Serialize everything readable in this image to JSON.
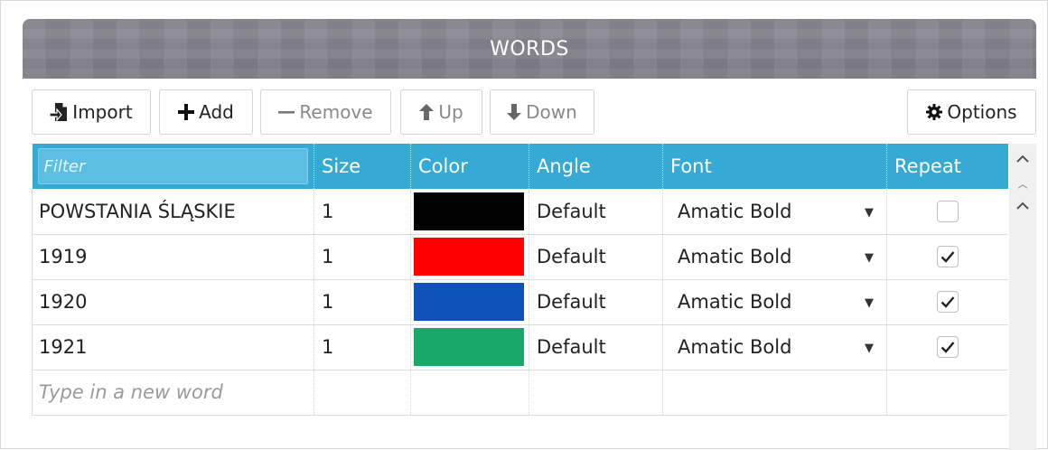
{
  "panel": {
    "title": "WORDS"
  },
  "toolbar": {
    "import_label": "Import",
    "add_label": "Add",
    "remove_label": "Remove",
    "up_label": "Up",
    "down_label": "Down",
    "options_label": "Options"
  },
  "table": {
    "filter_placeholder": "Filter",
    "columns": [
      "Size",
      "Color",
      "Angle",
      "Font",
      "Repeat"
    ],
    "rows": [
      {
        "word": "POWSTANIA ŚLĄSKIE",
        "size": "1",
        "color": "#000000",
        "angle": "Default",
        "font": "Amatic Bold",
        "repeat": false
      },
      {
        "word": "1919",
        "size": "1",
        "color": "#ff0000",
        "angle": "Default",
        "font": "Amatic Bold",
        "repeat": true
      },
      {
        "word": "1920",
        "size": "1",
        "color": "#0f52ba",
        "angle": "Default",
        "font": "Amatic Bold",
        "repeat": true
      },
      {
        "word": "1921",
        "size": "1",
        "color": "#1aa86b",
        "angle": "Default",
        "font": "Amatic Bold",
        "repeat": true
      }
    ],
    "new_word_placeholder": "Type in a new word"
  },
  "colors": {
    "header_bar": "#85848d",
    "grid_header": "#35aad5"
  },
  "icons": {
    "import": "import-icon",
    "add": "plus-icon",
    "remove": "minus-icon",
    "up": "arrow-up-icon",
    "down": "arrow-down-icon",
    "options": "gear-icon",
    "font_dropdown": "caret-down-icon",
    "repeat": "checkmark-icon"
  }
}
